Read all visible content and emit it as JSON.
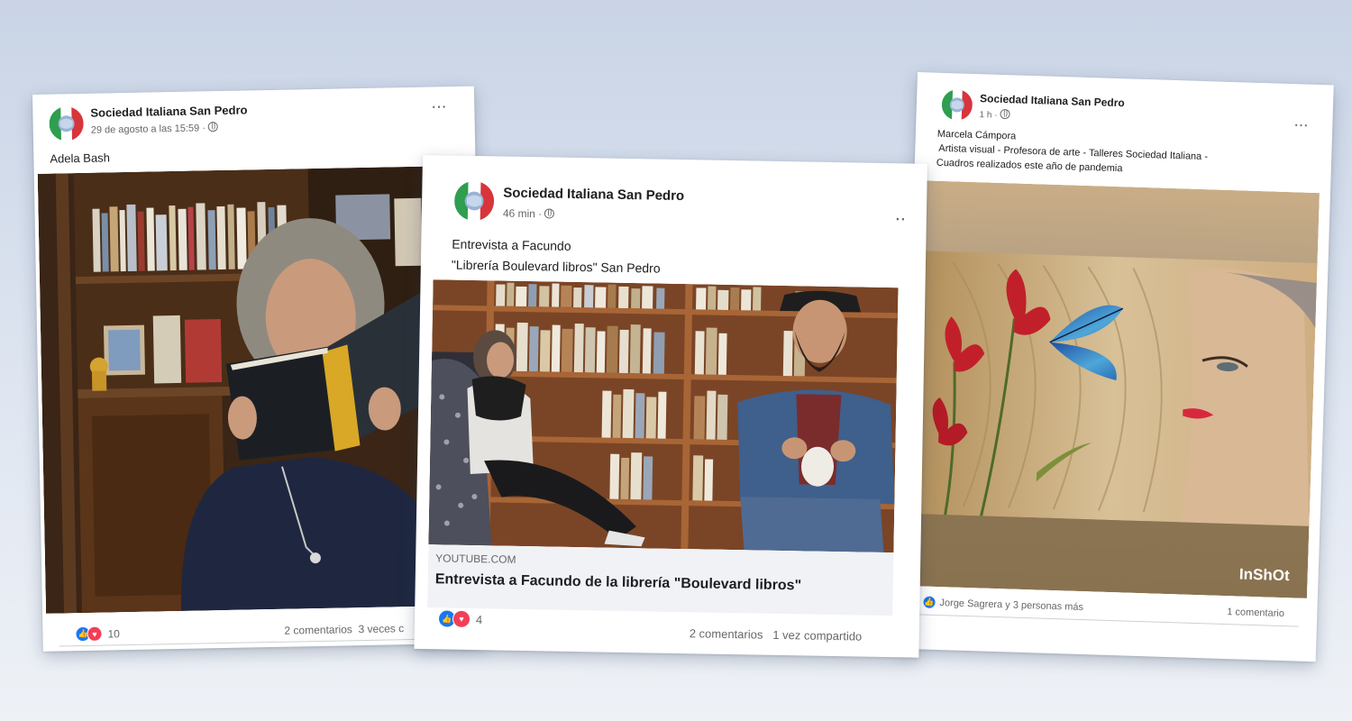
{
  "posts": [
    {
      "page_name": "Sociedad Italiana San Pedro",
      "timestamp": "29 de agosto a las 15:59 ·",
      "text": "Adela Bash",
      "reaction_count": "10",
      "comments": "2 comentarios",
      "shares": "3 veces c"
    },
    {
      "page_name": "Sociedad Italiana San Pedro",
      "timestamp": "46 min ·",
      "text_line1": "Entrevista a Facundo",
      "text_line2": "\"Librería Boulevard libros\" San Pedro",
      "link_domain": "YOUTUBE.COM",
      "link_title": "Entrevista a Facundo de la librería \"Boulevard libros\"",
      "reaction_count": "4",
      "comments": "2 comentarios",
      "shares": "1 vez compartido"
    },
    {
      "page_name": "Sociedad Italiana San Pedro",
      "timestamp": "1 h ·",
      "author": "Marcela Cámpora",
      "line2": "Artista visual - Profesora de arte - Talleres Sociedad Italiana -",
      "line3": "Cuadros realizados este año de pandemia",
      "watermark": "InShOt",
      "reactors": "Jorge Sagrera y 3 personas más",
      "comments": "1 comentario"
    }
  ],
  "colors": {
    "like": "#1877f2",
    "love": "#f33e58",
    "text": "#1c1e21",
    "meta": "#65676b"
  },
  "icons": [
    "page-avatar-icon",
    "globe-icon",
    "more-options-icon",
    "like-reaction-icon",
    "love-reaction-icon"
  ]
}
